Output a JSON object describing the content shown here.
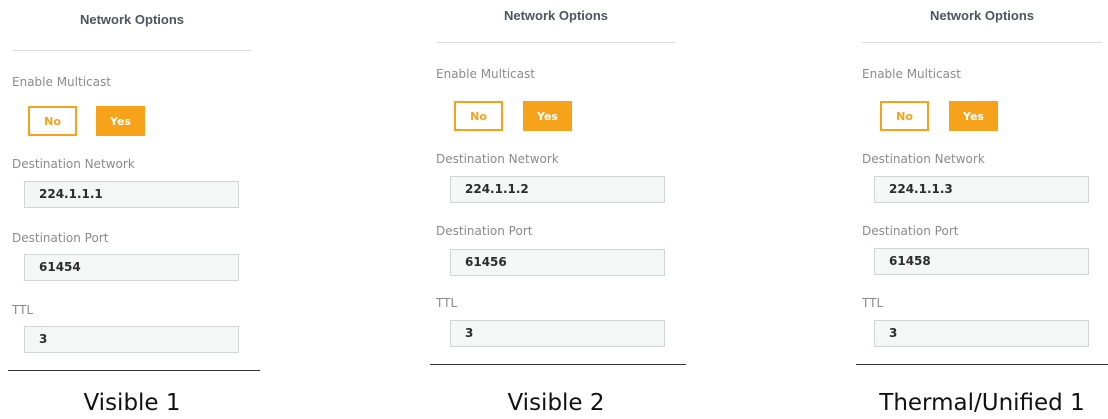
{
  "panels": [
    {
      "title": "Network Options",
      "enable_multicast_label": "Enable Multicast",
      "no_label": "No",
      "yes_label": "Yes",
      "dest_network_label": "Destination Network",
      "dest_network_value": "224.1.1.1",
      "dest_port_label": "Destination Port",
      "dest_port_value": "61454",
      "ttl_label": "TTL",
      "ttl_value": "3",
      "caption": "Visible 1"
    },
    {
      "title": "Network Options",
      "enable_multicast_label": "Enable Multicast",
      "no_label": "No",
      "yes_label": "Yes",
      "dest_network_label": "Destination Network",
      "dest_network_value": "224.1.1.2",
      "dest_port_label": "Destination Port",
      "dest_port_value": "61456",
      "ttl_label": "TTL",
      "ttl_value": "3",
      "caption": "Visible 2"
    },
    {
      "title": "Network Options",
      "enable_multicast_label": "Enable Multicast",
      "no_label": "No",
      "yes_label": "Yes",
      "dest_network_label": "Destination Network",
      "dest_network_value": "224.1.1.3",
      "dest_port_label": "Destination Port",
      "dest_port_value": "61458",
      "ttl_label": "TTL",
      "ttl_value": "3",
      "caption": "Thermal/Unified 1"
    }
  ],
  "colors": {
    "accent": "#f7a21b",
    "label": "#8b8b8b",
    "title": "#4f5360",
    "field_bg": "#f5f6f6"
  }
}
